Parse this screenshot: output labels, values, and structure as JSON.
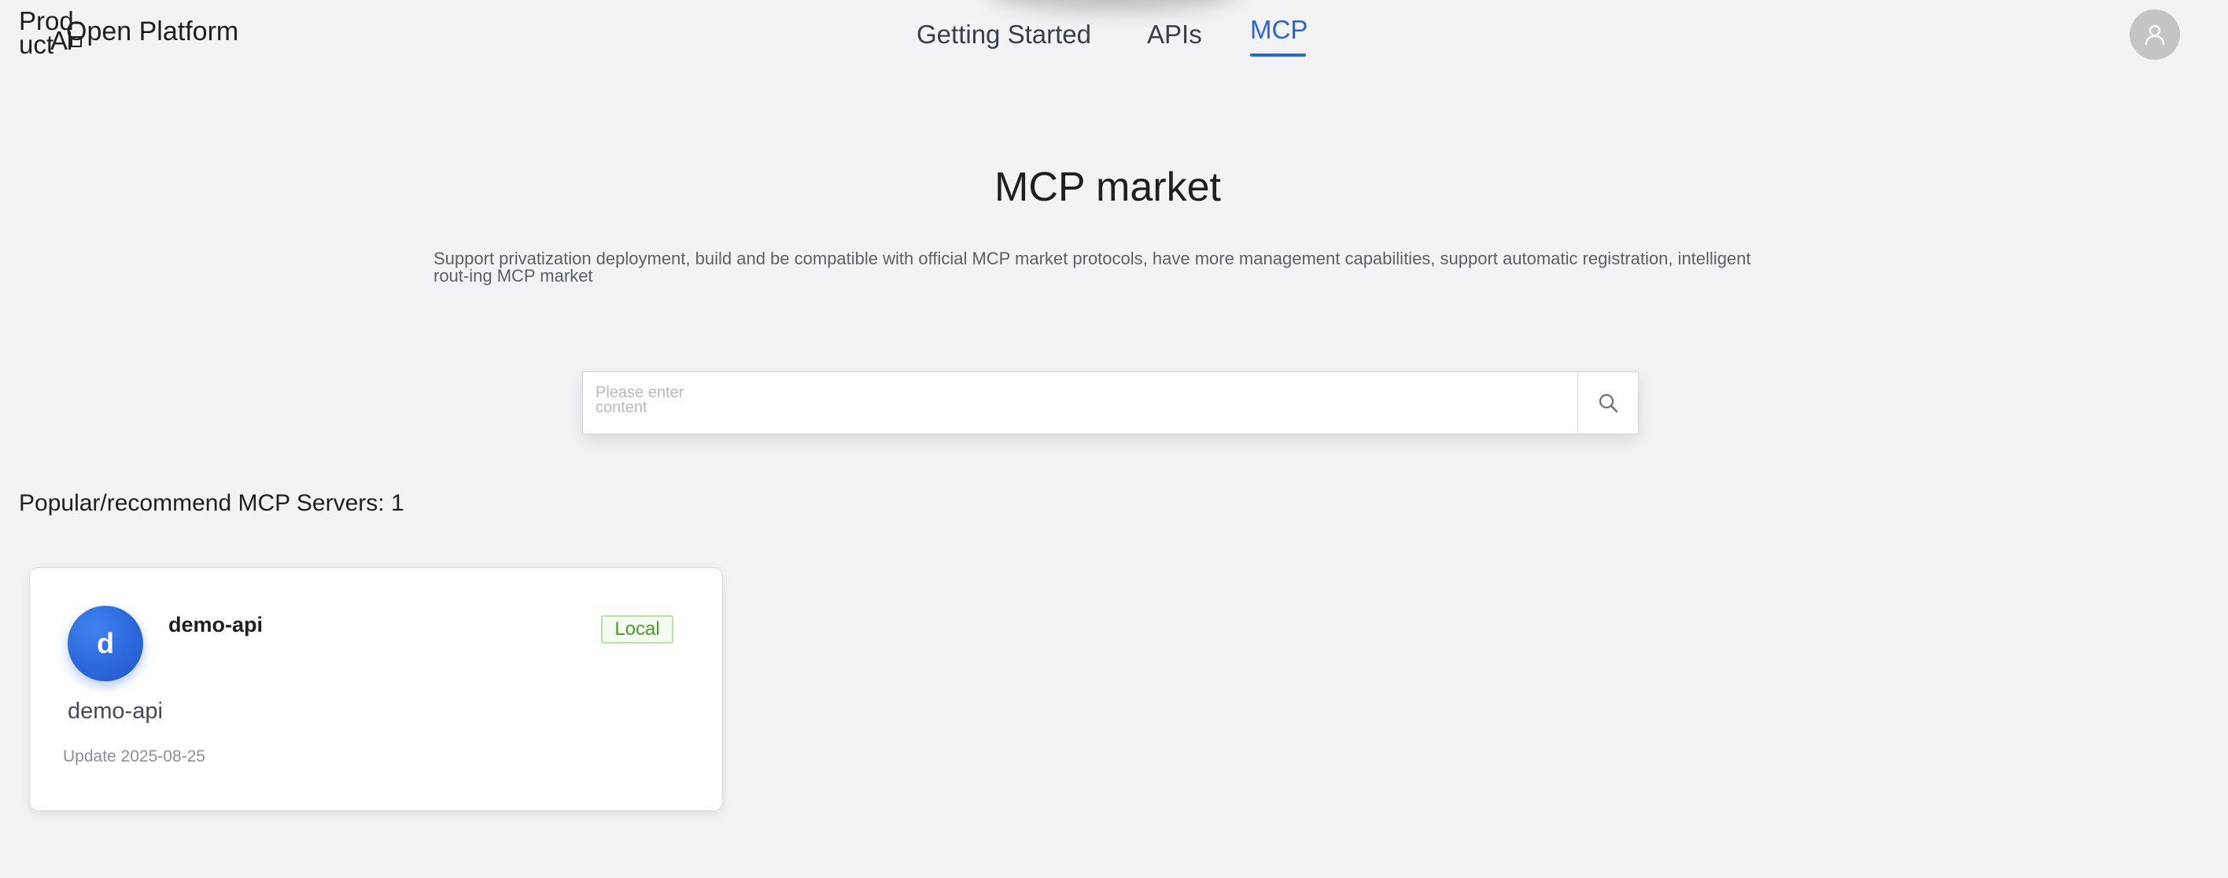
{
  "header": {
    "brand_product": "Prod-uct",
    "brand_logo_text": "AI",
    "brand_title": "Open Platform",
    "nav": [
      {
        "label": "Getting Started",
        "active": false
      },
      {
        "label": "APIs",
        "active": false
      },
      {
        "label": "MCP",
        "active": true
      }
    ],
    "avatar_icon": "user-icon"
  },
  "hero": {
    "title": "MCP market",
    "description": "Support privatization deployment, build and be compatible with official MCP market protocols, have more management capabilities, support automatic registration, intelligent rout-ing MCP market"
  },
  "search": {
    "placeholder": "Please enter content",
    "button_icon": "search-icon"
  },
  "section": {
    "label": "Popular/recommend MCP Servers: 1"
  },
  "servers": [
    {
      "avatar_letter": "d",
      "name": "demo-api",
      "tag": "Local",
      "description": "demo-api",
      "update": "Update 2025-08-25"
    }
  ],
  "colors": {
    "accent": "#2b66d8",
    "background": "#f3f3f5",
    "tag_green": "#4b9b2d",
    "tag_border": "#b7e3a8"
  }
}
